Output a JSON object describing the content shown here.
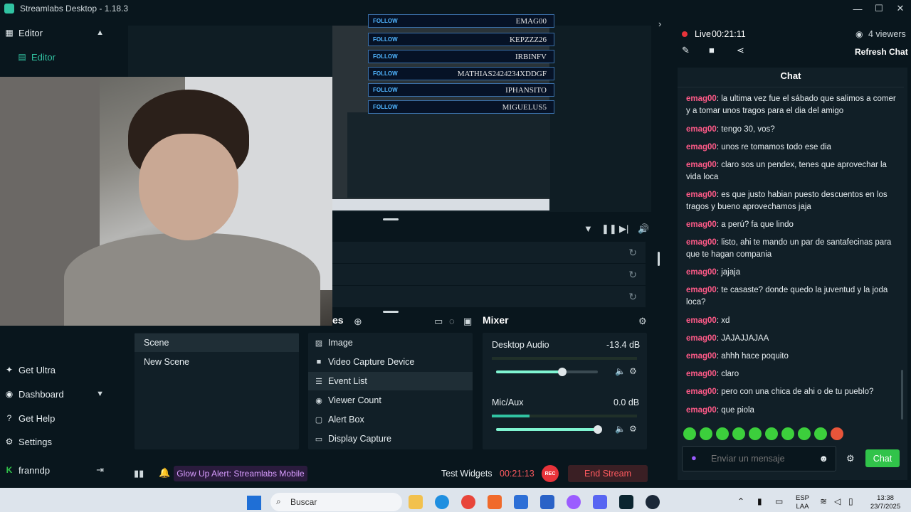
{
  "window": {
    "title": "Streamlabs Desktop - 1.18.3",
    "controls": [
      "—",
      "☐",
      "✕"
    ]
  },
  "sidebar": {
    "editor_group": "Editor",
    "editor_item": "Editor",
    "bottom": [
      {
        "label": "Get Ultra",
        "icon": "ultra-icon"
      },
      {
        "label": "Dashboard",
        "icon": "dashboard-icon"
      },
      {
        "label": "Get Help",
        "icon": "help-icon"
      },
      {
        "label": "Settings",
        "icon": "gear-icon"
      }
    ],
    "user": "franndp"
  },
  "follows": [
    {
      "label": "FOLLOW",
      "name": "EMAG00"
    },
    {
      "label": "FOLLOW",
      "name": "KEPZZZ26"
    },
    {
      "label": "FOLLOW",
      "name": "IRBINFV"
    },
    {
      "label": "FOLLOW",
      "name": "MATHIAS2424234XDDGF"
    },
    {
      "label": "FOLLOW",
      "name": "IPHANSITO"
    },
    {
      "label": "FOLLOW",
      "name": "MIGUELUS5"
    }
  ],
  "sections": {
    "sources_tail": "es",
    "mixer": "Mixer"
  },
  "scenes": [
    "Scene",
    "New Scene"
  ],
  "sources": [
    {
      "label": "Image",
      "icon": "image-icon"
    },
    {
      "label": "Video Capture Device",
      "icon": "camera-icon"
    },
    {
      "label": "Event List",
      "icon": "list-icon"
    },
    {
      "label": "Viewer Count",
      "icon": "eye-icon"
    },
    {
      "label": "Alert Box",
      "icon": "alert-box-icon"
    },
    {
      "label": "Display Capture",
      "icon": "monitor-icon"
    }
  ],
  "mixer": {
    "desktop": {
      "label": "Desktop Audio",
      "db": "-13.4 dB",
      "level": 0.65
    },
    "mic": {
      "label": "Mic/Aux",
      "db": "0.0 dB",
      "level": 1.0
    }
  },
  "footer": {
    "glow": "Glow Up Alert: Streamlabs Mobile",
    "test_widgets": "Test Widgets",
    "timer": "00:21:13",
    "rec": "REC",
    "end_stream": "End Stream"
  },
  "stream": {
    "live": "Live",
    "time": "00:21:11",
    "viewers": "4 viewers",
    "refresh": "Refresh Chat"
  },
  "chat": {
    "title": "Chat",
    "messages": [
      {
        "user": "emag00",
        "text": "la ultima vez fue el sábado que salimos a comer y a tomar unos tragos para el dia del amigo"
      },
      {
        "user": "emag00",
        "text": "tengo 30, vos?"
      },
      {
        "user": "emag00",
        "text": "unos re tomamos todo ese dia"
      },
      {
        "user": "emag00",
        "text": "claro sos un pendex, tenes que aprovechar la vida loca"
      },
      {
        "user": "emag00",
        "text": "es que justo habian puesto descuentos en los tragos y bueno aprovechamos jaja"
      },
      {
        "user": "emag00",
        "text": "a perú? fa que lindo"
      },
      {
        "user": "emag00",
        "text": "listo, ahi te mando un par de santafecinas para que te hagan compania"
      },
      {
        "user": "emag00",
        "text": "jajaja"
      },
      {
        "user": "emag00",
        "text": "te casaste? donde quedo la juventud y la joda loca?"
      },
      {
        "user": "emag00",
        "text": "xd"
      },
      {
        "user": "emag00",
        "text": "JAJAJJAJAA"
      },
      {
        "user": "emag00",
        "text": "ahhh hace poquito"
      },
      {
        "user": "emag00",
        "text": "claro"
      },
      {
        "user": "emag00",
        "text": "pero con una chica de ahi o de tu pueblo?"
      },
      {
        "user": "emag00",
        "text": "que piola"
      }
    ],
    "input_placeholder": "Enviar un mensaje",
    "send": "Chat"
  },
  "taskbar": {
    "search": "Buscar",
    "lang": "ESP",
    "region": "LAA",
    "time": "13:38",
    "date": "23/7/2025"
  }
}
